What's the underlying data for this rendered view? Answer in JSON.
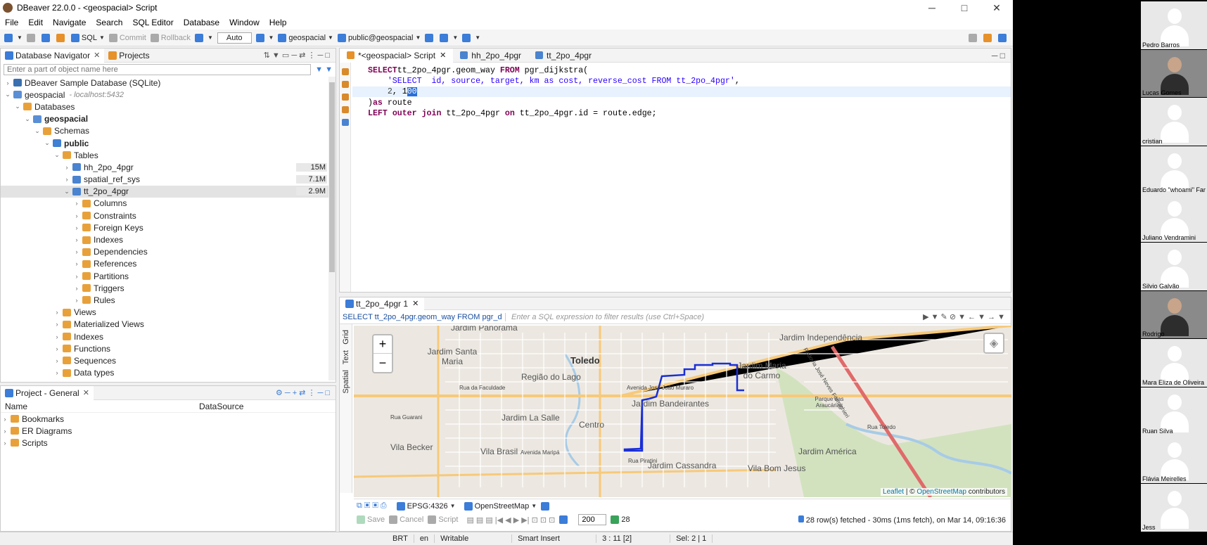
{
  "window": {
    "title": "DBeaver 22.0.0 - <geospacial> Script",
    "minimize": "─",
    "maximize": "□",
    "close": "✕"
  },
  "menu": [
    "File",
    "Edit",
    "Navigate",
    "Search",
    "SQL Editor",
    "Database",
    "Window",
    "Help"
  ],
  "toolbar": {
    "sql": "SQL",
    "commit": "Commit",
    "rollback": "Rollback",
    "auto": "Auto",
    "datasource": "geospacial",
    "schema": "public@geospacial"
  },
  "navigator": {
    "tabs": [
      "Database Navigator",
      "Projects"
    ],
    "filter_placeholder": "Enter a part of object name here",
    "tree": [
      {
        "label": "DBeaver Sample Database (SQLite)",
        "depth": 0,
        "arrow": "›",
        "icon": "sqlite"
      },
      {
        "label": "geospacial",
        "note": "- localhost:5432",
        "depth": 0,
        "arrow": "⌄",
        "icon": "db"
      },
      {
        "label": "Databases",
        "depth": 1,
        "arrow": "⌄",
        "icon": "folder"
      },
      {
        "label": "geospacial",
        "depth": 2,
        "arrow": "⌄",
        "icon": "db",
        "bold": true
      },
      {
        "label": "Schemas",
        "depth": 3,
        "arrow": "⌄",
        "icon": "folder"
      },
      {
        "label": "public",
        "depth": 4,
        "arrow": "⌄",
        "icon": "schema",
        "bold": true
      },
      {
        "label": "Tables",
        "depth": 5,
        "arrow": "⌄",
        "icon": "folder"
      },
      {
        "label": "hh_2po_4pgr",
        "depth": 6,
        "arrow": "›",
        "icon": "table",
        "size": "15M"
      },
      {
        "label": "spatial_ref_sys",
        "depth": 6,
        "arrow": "›",
        "icon": "table",
        "size": "7.1M"
      },
      {
        "label": "tt_2po_4pgr",
        "depth": 6,
        "arrow": "⌄",
        "icon": "table",
        "size": "2.9M",
        "selected": true
      },
      {
        "label": "Columns",
        "depth": 7,
        "arrow": "›",
        "icon": "folder"
      },
      {
        "label": "Constraints",
        "depth": 7,
        "arrow": "›",
        "icon": "folder"
      },
      {
        "label": "Foreign Keys",
        "depth": 7,
        "arrow": "›",
        "icon": "folder"
      },
      {
        "label": "Indexes",
        "depth": 7,
        "arrow": "›",
        "icon": "folder"
      },
      {
        "label": "Dependencies",
        "depth": 7,
        "arrow": "›",
        "icon": "folder"
      },
      {
        "label": "References",
        "depth": 7,
        "arrow": "›",
        "icon": "folder"
      },
      {
        "label": "Partitions",
        "depth": 7,
        "arrow": "›",
        "icon": "folder"
      },
      {
        "label": "Triggers",
        "depth": 7,
        "arrow": "›",
        "icon": "folder"
      },
      {
        "label": "Rules",
        "depth": 7,
        "arrow": "›",
        "icon": "folder"
      },
      {
        "label": "Views",
        "depth": 5,
        "arrow": "›",
        "icon": "folder"
      },
      {
        "label": "Materialized Views",
        "depth": 5,
        "arrow": "›",
        "icon": "folder"
      },
      {
        "label": "Indexes",
        "depth": 5,
        "arrow": "›",
        "icon": "folder"
      },
      {
        "label": "Functions",
        "depth": 5,
        "arrow": "›",
        "icon": "folder"
      },
      {
        "label": "Sequences",
        "depth": 5,
        "arrow": "›",
        "icon": "folder"
      },
      {
        "label": "Data types",
        "depth": 5,
        "arrow": "›",
        "icon": "folder"
      }
    ]
  },
  "project": {
    "title": "Project - General",
    "columns": [
      "Name",
      "DataSource"
    ],
    "items": [
      "Bookmarks",
      "ER Diagrams",
      "Scripts"
    ]
  },
  "editor": {
    "tabs": [
      "*<geospacial> Script",
      "hh_2po_4pgr",
      "tt_2po_4pgr"
    ],
    "lines": [
      {
        "segments": [
          [
            "kw",
            "SELECT"
          ],
          [
            "",
            "tt_2po_4pgr.geom_way "
          ],
          [
            "kw",
            "FROM"
          ],
          [
            "",
            " pgr_dijkstra("
          ]
        ]
      },
      {
        "segments": [
          [
            "",
            "    "
          ],
          [
            "str",
            "'SELECT  id, source, target, km as cost, reverse_cost FROM tt_2po_4pgr'"
          ],
          [
            "",
            ","
          ]
        ]
      },
      {
        "segments": [
          [
            "",
            "    "
          ],
          [
            "num",
            "2"
          ],
          [
            "",
            ", 1"
          ],
          [
            "hl",
            "00"
          ]
        ]
      },
      {
        "segments": [
          [
            "",
            ")"
          ],
          [
            "kw",
            "as"
          ],
          [
            "",
            " route"
          ]
        ]
      },
      {
        "segments": [
          [
            "kw",
            "LEFT"
          ],
          [
            "",
            " "
          ],
          [
            "kw",
            "outer"
          ],
          [
            "",
            " "
          ],
          [
            "kw",
            "join"
          ],
          [
            "",
            " tt_2po_4pgr "
          ],
          [
            "kw",
            "on"
          ],
          [
            "",
            " tt_2po_4pgr.id = route.edge;"
          ]
        ]
      }
    ]
  },
  "results": {
    "tab": "tt_2po_4pgr 1",
    "query": "SELECT tt_2po_4pgr.geom_way FROM pgr_d",
    "filter_placeholder": "Enter a SQL expression to filter results (use Ctrl+Space)",
    "side_tabs": [
      "Grid",
      "Text",
      "Spatial"
    ],
    "map": {
      "zoom_in": "+",
      "zoom_out": "−",
      "labels": [
        {
          "text": "Jardim Panorama",
          "k": "n"
        },
        {
          "text": "Jardim Santa Maria",
          "k": "n"
        },
        {
          "text": "Toledo",
          "k": "big"
        },
        {
          "text": "Região do Lago",
          "k": "n"
        },
        {
          "text": "Jardim Independência",
          "k": "n"
        },
        {
          "text": "Jardim Maria do Carmo",
          "k": "n"
        },
        {
          "text": "Jardim Bandeirantes",
          "k": "n"
        },
        {
          "text": "Jardim La Salle",
          "k": "n"
        },
        {
          "text": "Centro",
          "k": "n"
        },
        {
          "text": "Vila Becker",
          "k": "n"
        },
        {
          "text": "Vila Brasil",
          "k": "n"
        },
        {
          "text": "Jardim Cassandra",
          "k": "n"
        },
        {
          "text": "Vila Bom Jesus",
          "k": "n"
        },
        {
          "text": "Jardim América",
          "k": "n"
        },
        {
          "text": "Parque das Araucárias",
          "k": "s"
        },
        {
          "text": "Rua da Faculdade",
          "k": "s"
        },
        {
          "text": "Rua Guarani",
          "k": "s"
        },
        {
          "text": "Avenida José João Muraro",
          "k": "s"
        },
        {
          "text": "Avenida Maripá",
          "k": "s"
        },
        {
          "text": "Rua Piratini",
          "k": "s"
        },
        {
          "text": "Rua Toledo",
          "k": "s"
        },
        {
          "text": "Rodovia José Neves Formighieri",
          "k": "s"
        }
      ],
      "attribution_leaflet": "Leaflet",
      "attribution_sep": " | © ",
      "attribution_osm": "OpenStreetMap",
      "attribution_tail": " contributors"
    },
    "crs": "EPSG:4326",
    "tiles": "OpenStreetMap",
    "actions": [
      "Save",
      "Cancel",
      "Script"
    ],
    "limit": "200",
    "row_count": "28",
    "status_text": "28 row(s) fetched - 30ms (1ms fetch), on Mar 14, 09:16:36"
  },
  "statusbar": [
    "BRT",
    "en",
    "Writable",
    "Smart Insert",
    "3 : 11 [2]",
    "Sel: 2 | 1"
  ],
  "participants": [
    {
      "name": "Pedro Barros",
      "cam": false
    },
    {
      "name": "Lucas Gomes",
      "cam": true
    },
    {
      "name": "cristian",
      "cam": false
    },
    {
      "name": "Eduardo \"whoami\" Far",
      "cam": false
    },
    {
      "name": "Juliano Vendramini",
      "cam": false
    },
    {
      "name": "Silvio Galvão",
      "cam": false
    },
    {
      "name": "Rodrigo",
      "cam": true
    },
    {
      "name": "Mara Eliza de Oliveira",
      "cam": false
    },
    {
      "name": "Ruan Silva",
      "cam": false
    },
    {
      "name": "Flávia Meirelles",
      "cam": false
    },
    {
      "name": "Jess",
      "cam": false
    }
  ],
  "colors": {
    "route": "#1a2fd6",
    "major_road": "#f7c97a",
    "railway": "#e06a6a",
    "park": "#c8dfb0"
  }
}
